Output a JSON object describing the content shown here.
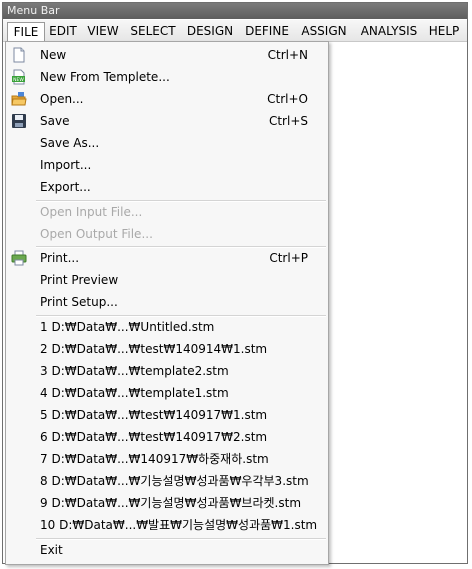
{
  "window": {
    "title": "Menu Bar"
  },
  "menubar": {
    "items": [
      {
        "label": "FILE"
      },
      {
        "label": "EDIT"
      },
      {
        "label": "VIEW"
      },
      {
        "label": "SELECT"
      },
      {
        "label": "DESIGN"
      },
      {
        "label": "DEFINE"
      },
      {
        "label": "ASSIGN"
      },
      {
        "label": "ANALYSIS"
      },
      {
        "label": "HELP"
      }
    ]
  },
  "file_menu": {
    "new": {
      "label": "New",
      "shortcut": "Ctrl+N",
      "icon": "new-document-icon"
    },
    "new_from_template": {
      "label": "New From Templete...",
      "icon": "new-template-icon"
    },
    "open": {
      "label": "Open...",
      "shortcut": "Ctrl+O",
      "icon": "open-folder-icon"
    },
    "save": {
      "label": "Save",
      "shortcut": "Ctrl+S",
      "icon": "floppy-disk-icon"
    },
    "save_as": {
      "label": "Save As..."
    },
    "import": {
      "label": "Import..."
    },
    "export": {
      "label": "Export..."
    },
    "open_input": {
      "label": "Open Input File..."
    },
    "open_output": {
      "label": "Open Output File..."
    },
    "print": {
      "label": "Print...",
      "shortcut": "Ctrl+P",
      "icon": "printer-icon"
    },
    "print_preview": {
      "label": "Print Preview"
    },
    "print_setup": {
      "label": "Print Setup..."
    },
    "recent_files": [
      "1 D:₩Data₩...₩Untitled.stm",
      "2 D:₩Data₩...₩test₩140914₩1.stm",
      "3 D:₩Data₩...₩template2.stm",
      "4 D:₩Data₩...₩template1.stm",
      "5 D:₩Data₩...₩test₩140917₩1.stm",
      "6 D:₩Data₩...₩test₩140917₩2.stm",
      "7 D:₩Data₩...₩140917₩하중재하.stm",
      "8 D:₩Data₩...₩기능설명₩성과품₩우각부3.stm",
      "9 D:₩Data₩...₩기능설명₩성과품₩브라켓.stm",
      "10 D:₩Data₩...₩발표₩기능설명₩성과품₩1.stm"
    ],
    "exit": {
      "label": "Exit"
    }
  }
}
